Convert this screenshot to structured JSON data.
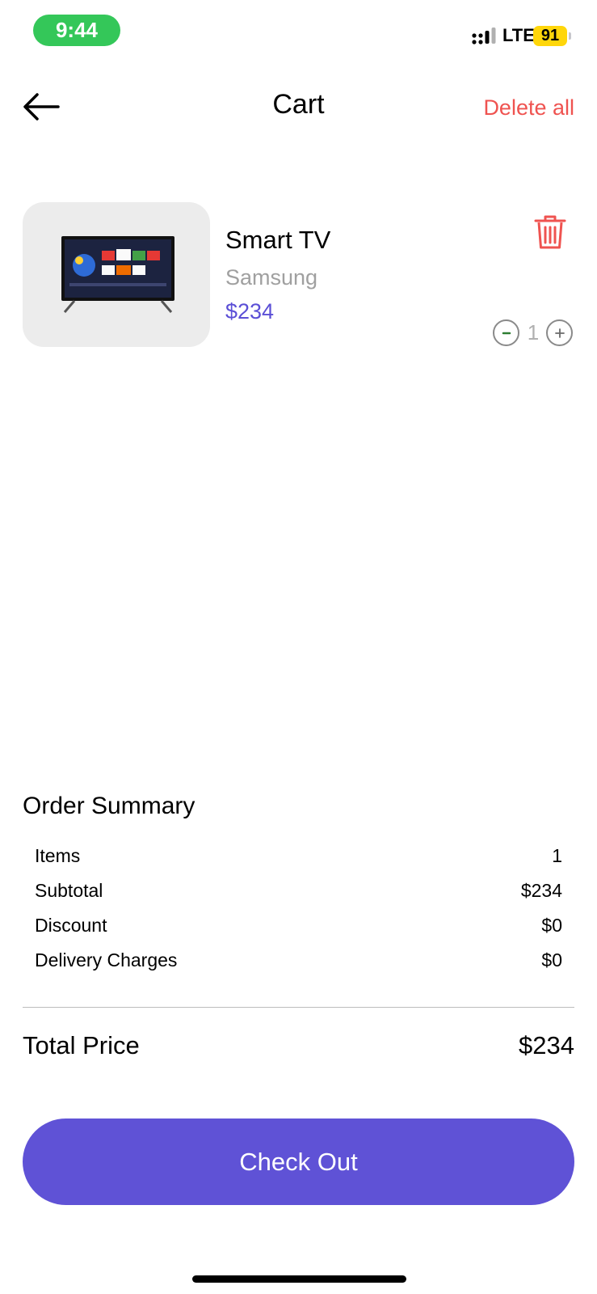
{
  "status_bar": {
    "time": "9:44",
    "network": "LTE",
    "battery": "91"
  },
  "header": {
    "title": "Cart",
    "delete_all_label": "Delete all",
    "back_icon": "arrow-left-icon"
  },
  "cart": {
    "items": [
      {
        "name": "Smart TV",
        "brand": "Samsung",
        "price": "$234",
        "quantity": "1",
        "image_icon": "smart-tv-image"
      }
    ]
  },
  "order_summary": {
    "title": "Order Summary",
    "rows": [
      {
        "label": "Items",
        "value": "1"
      },
      {
        "label": "Subtotal",
        "value": "$234"
      },
      {
        "label": "Discount",
        "value": "$0"
      },
      {
        "label": "Delivery Charges",
        "value": "$0"
      }
    ],
    "total_label": "Total Price",
    "total_value": "$234"
  },
  "checkout_label": "Check Out",
  "colors": {
    "accent": "#5f52d6",
    "danger": "#ef5350",
    "status_green": "#34c759",
    "battery_yellow": "#ffd60a"
  }
}
